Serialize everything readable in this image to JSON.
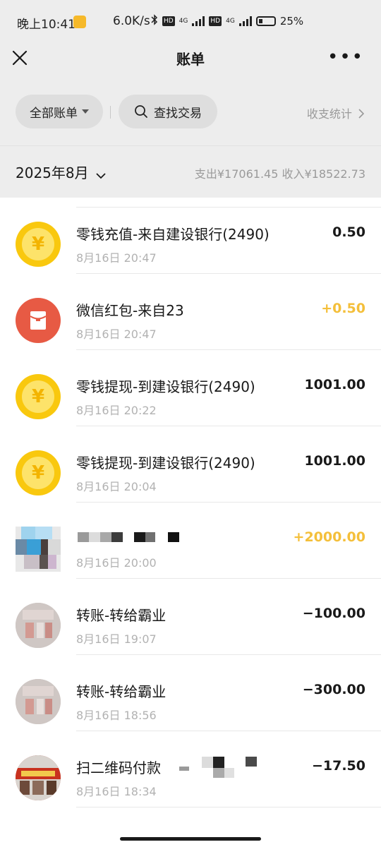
{
  "status_bar": {
    "time": "晚上10:41",
    "net_speed": "6.0K/s",
    "hd1": "HD",
    "net1": "4G",
    "hd2": "HD",
    "net2": "4G",
    "battery": "25%"
  },
  "nav": {
    "title": "账单",
    "more": "•••"
  },
  "filters": {
    "all_bills": "全部账单",
    "search": "查找交易",
    "stats": "收支统计"
  },
  "month": {
    "label": "2025年8月",
    "summary": "支出¥17061.45 收入¥18522.73"
  },
  "transactions": [
    {
      "name": "零钱充值-来自建设银行(2490)",
      "time": "8月16日 20:47",
      "amount": "0.50",
      "icon": "coin-icon"
    },
    {
      "name": "微信红包-来自23",
      "time": "8月16日 20:47",
      "amount": "+0.50",
      "icon": "red-packet-icon"
    },
    {
      "name": "零钱提现-到建设银行(2490)",
      "time": "8月16日 20:22",
      "amount": "1001.00",
      "icon": "coin-icon"
    },
    {
      "name": "零钱提现-到建设银行(2490)",
      "time": "8月16日 20:04",
      "amount": "1001.00",
      "icon": "coin-icon"
    },
    {
      "name": "",
      "time": "8月16日 20:00",
      "amount": "+2000.00",
      "icon": "pixelated-avatar"
    },
    {
      "name": "转账-转给霸业",
      "time": "8月16日 19:07",
      "amount": "−100.00",
      "icon": "shop-avatar"
    },
    {
      "name": "转账-转给霸业",
      "time": "8月16日 18:56",
      "amount": "−300.00",
      "icon": "shop-avatar"
    },
    {
      "name": "扫二维码付款",
      "time": "8月16日 18:34",
      "amount": "−17.50",
      "icon": "store-avatar"
    }
  ],
  "colors": {
    "income": "#f4bf3a",
    "coin": "#f9c80e",
    "red_packet": "#e75a44",
    "header_bg": "#ededed"
  }
}
